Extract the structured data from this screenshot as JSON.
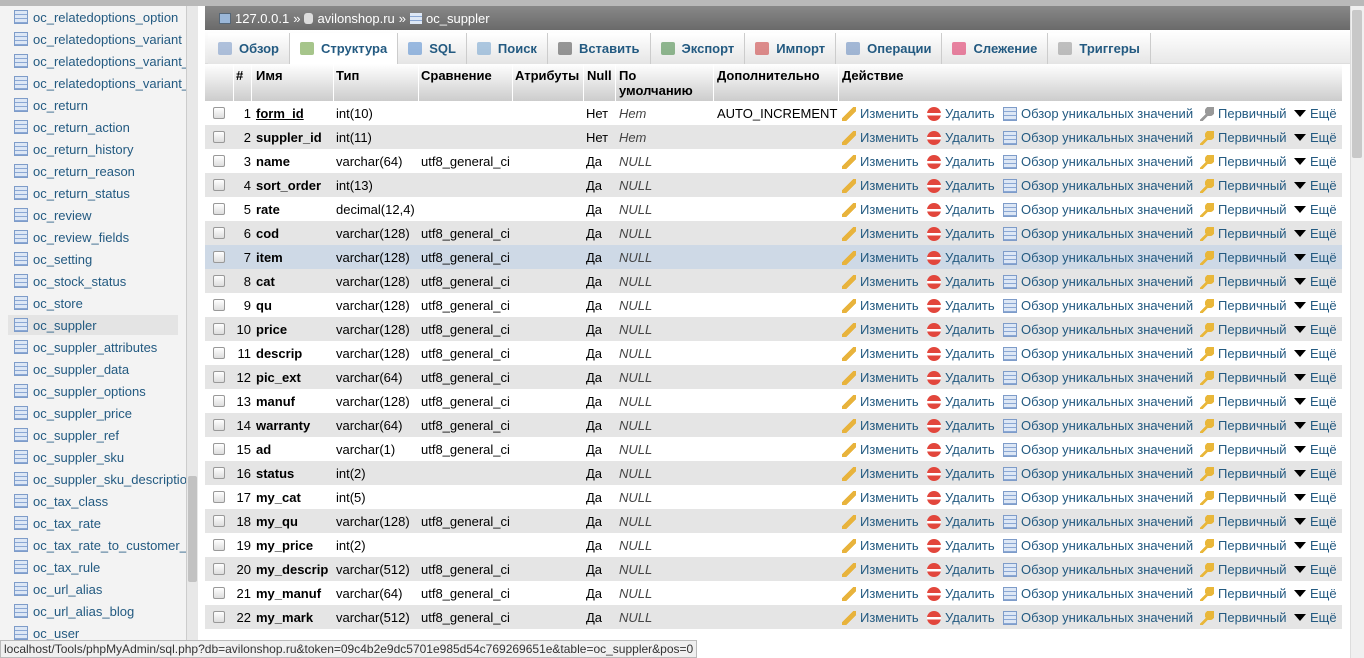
{
  "sidebar": {
    "tables": [
      "oc_relatedoptions_option",
      "oc_relatedoptions_variant",
      "oc_relatedoptions_variant_",
      "oc_relatedoptions_variant_",
      "oc_return",
      "oc_return_action",
      "oc_return_history",
      "oc_return_reason",
      "oc_return_status",
      "oc_review",
      "oc_review_fields",
      "oc_setting",
      "oc_stock_status",
      "oc_store",
      "oc_suppler",
      "oc_suppler_attributes",
      "oc_suppler_data",
      "oc_suppler_options",
      "oc_suppler_price",
      "oc_suppler_ref",
      "oc_suppler_sku",
      "oc_suppler_sku_descriptio",
      "oc_tax_class",
      "oc_tax_rate",
      "oc_tax_rate_to_customer_",
      "oc_tax_rule",
      "oc_url_alias",
      "oc_url_alias_blog",
      "oc_user"
    ],
    "active": "oc_suppler"
  },
  "breadcrumb": {
    "server": "127.0.0.1",
    "sep": "»",
    "database": "avilonshop.ru",
    "table": "oc_suppler"
  },
  "tabs": [
    "Обзор",
    "Структура",
    "SQL",
    "Поиск",
    "Вставить",
    "Экспорт",
    "Импорт",
    "Операции",
    "Слежение",
    "Триггеры"
  ],
  "active_tab": "Структура",
  "columns": {
    "num": "#",
    "name": "Имя",
    "type": "Тип",
    "collation": "Сравнение",
    "attributes": "Атрибуты",
    "null": "Null",
    "default": "По умолчанию",
    "extra": "Дополнительно",
    "action": "Действие"
  },
  "actions": {
    "edit": "Изменить",
    "drop": "Удалить",
    "browse": "Обзор уникальных значений",
    "primary": "Первичный",
    "more": "Ещё"
  },
  "rows": [
    {
      "n": "1",
      "name": "form_id",
      "type": "int(10)",
      "coll": "",
      "null": "Нет",
      "def": "Нет",
      "extra": "AUTO_INCREMENT"
    },
    {
      "n": "2",
      "name": "suppler_id",
      "type": "int(11)",
      "coll": "",
      "null": "Нет",
      "def": "Нет",
      "extra": ""
    },
    {
      "n": "3",
      "name": "name",
      "type": "varchar(64)",
      "coll": "utf8_general_ci",
      "null": "Да",
      "def": "NULL",
      "extra": ""
    },
    {
      "n": "4",
      "name": "sort_order",
      "type": "int(13)",
      "coll": "",
      "null": "Да",
      "def": "NULL",
      "extra": ""
    },
    {
      "n": "5",
      "name": "rate",
      "type": "decimal(12,4)",
      "coll": "",
      "null": "Да",
      "def": "NULL",
      "extra": ""
    },
    {
      "n": "6",
      "name": "cod",
      "type": "varchar(128)",
      "coll": "utf8_general_ci",
      "null": "Да",
      "def": "NULL",
      "extra": ""
    },
    {
      "n": "7",
      "name": "item",
      "type": "varchar(128)",
      "coll": "utf8_general_ci",
      "null": "Да",
      "def": "NULL",
      "extra": ""
    },
    {
      "n": "8",
      "name": "cat",
      "type": "varchar(128)",
      "coll": "utf8_general_ci",
      "null": "Да",
      "def": "NULL",
      "extra": ""
    },
    {
      "n": "9",
      "name": "qu",
      "type": "varchar(128)",
      "coll": "utf8_general_ci",
      "null": "Да",
      "def": "NULL",
      "extra": ""
    },
    {
      "n": "10",
      "name": "price",
      "type": "varchar(128)",
      "coll": "utf8_general_ci",
      "null": "Да",
      "def": "NULL",
      "extra": ""
    },
    {
      "n": "11",
      "name": "descrip",
      "type": "varchar(128)",
      "coll": "utf8_general_ci",
      "null": "Да",
      "def": "NULL",
      "extra": ""
    },
    {
      "n": "12",
      "name": "pic_ext",
      "type": "varchar(64)",
      "coll": "utf8_general_ci",
      "null": "Да",
      "def": "NULL",
      "extra": ""
    },
    {
      "n": "13",
      "name": "manuf",
      "type": "varchar(128)",
      "coll": "utf8_general_ci",
      "null": "Да",
      "def": "NULL",
      "extra": ""
    },
    {
      "n": "14",
      "name": "warranty",
      "type": "varchar(64)",
      "coll": "utf8_general_ci",
      "null": "Да",
      "def": "NULL",
      "extra": ""
    },
    {
      "n": "15",
      "name": "ad",
      "type": "varchar(1)",
      "coll": "utf8_general_ci",
      "null": "Да",
      "def": "NULL",
      "extra": ""
    },
    {
      "n": "16",
      "name": "status",
      "type": "int(2)",
      "coll": "",
      "null": "Да",
      "def": "NULL",
      "extra": ""
    },
    {
      "n": "17",
      "name": "my_cat",
      "type": "int(5)",
      "coll": "",
      "null": "Да",
      "def": "NULL",
      "extra": ""
    },
    {
      "n": "18",
      "name": "my_qu",
      "type": "varchar(128)",
      "coll": "utf8_general_ci",
      "null": "Да",
      "def": "NULL",
      "extra": ""
    },
    {
      "n": "19",
      "name": "my_price",
      "type": "int(2)",
      "coll": "",
      "null": "Да",
      "def": "NULL",
      "extra": ""
    },
    {
      "n": "20",
      "name": "my_descrip",
      "type": "varchar(512)",
      "coll": "utf8_general_ci",
      "null": "Да",
      "def": "NULL",
      "extra": ""
    },
    {
      "n": "21",
      "name": "my_manuf",
      "type": "varchar(64)",
      "coll": "utf8_general_ci",
      "null": "Да",
      "def": "NULL",
      "extra": ""
    },
    {
      "n": "22",
      "name": "my_mark",
      "type": "varchar(512)",
      "coll": "utf8_general_ci",
      "null": "Да",
      "def": "NULL",
      "extra": ""
    }
  ],
  "hover_row": 7,
  "status_url": "localhost/Tools/phpMyAdmin/sql.php?db=avilonshop.ru&token=09c4b2e9dc5701e985d54c769269651e&table=oc_suppler&pos=0"
}
